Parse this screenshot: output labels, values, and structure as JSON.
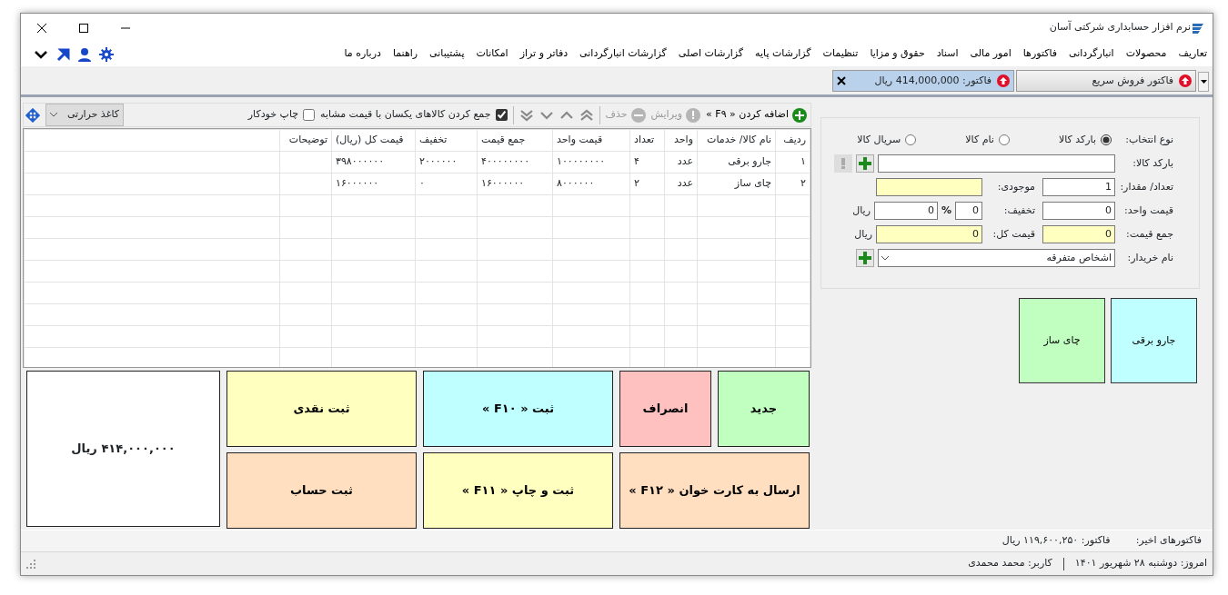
{
  "window": {
    "title": "نرم افزار حسابداری شرکتی آسان"
  },
  "menu": [
    "تعاریف",
    "محصولات",
    "انبارگردانی",
    "فاکتورها",
    "امور مالی",
    "اسناد",
    "حقوق و مزایا",
    "تنظیمات",
    "گزارشات پایه",
    "گزارشات اصلی",
    "گزارشات انبارگردانی",
    "دفاتر و تراز",
    "امکانات",
    "پشتیبانی",
    "راهنما",
    "درباره ما"
  ],
  "tabs": [
    {
      "label": "فاکتور فروش سریع",
      "selected": false,
      "closable": false
    },
    {
      "label": "فاکتور: 414,000,000 ریال",
      "selected": true,
      "closable": true
    }
  ],
  "toolbar": {
    "add": {
      "label": "اضافه کردن « F۹ »",
      "disabled": false
    },
    "edit": {
      "label": "ویرایش",
      "disabled": true
    },
    "delete": {
      "label": "حذف",
      "disabled": true
    },
    "merge_same": {
      "label": "جمع کردن کالاهای یکسان با قیمت مشابه",
      "checked": true
    },
    "auto_print": {
      "label": "چاپ خودکار",
      "checked": false
    },
    "paper": {
      "value": "کاغذ حرارتی"
    }
  },
  "table": {
    "columns": [
      "ردیف",
      "نام کالا/ خدمات",
      "واحد",
      "تعداد",
      "قیمت واحد",
      "جمع قیمت",
      "تخفیف",
      "قیمت کل (ریال)",
      "توضیحات"
    ],
    "rows": [
      [
        "۱",
        "جارو برقی",
        "عدد",
        "۴",
        "۱۰۰۰۰۰۰۰۰",
        "۴۰۰۰۰۰۰۰۰",
        "۲۰۰۰۰۰۰",
        "۳۹۸۰۰۰۰۰۰",
        ""
      ],
      [
        "۲",
        "چای ساز",
        "عدد",
        "۲",
        "۸۰۰۰۰۰۰",
        "۱۶۰۰۰۰۰۰",
        "۰",
        "۱۶۰۰۰۰۰۰",
        ""
      ]
    ]
  },
  "actions": {
    "row_1": [
      {
        "label": "جدید",
        "color": "#c0ffc0"
      },
      {
        "label": "انصراف",
        "color": "#ffc0c0"
      },
      {
        "label": "ثبت « F۱۰ »",
        "color": "#c0ffff"
      },
      {
        "label": "ثبت نقدی",
        "color": "#ffffc0"
      }
    ],
    "row_2": [
      {
        "label": "ارسال به کارت خوان « F۱۲ »",
        "color": "#ffdfc0"
      },
      {
        "label": "ثبت و چاپ « F۱۱ »",
        "color": "#ffffc0"
      },
      {
        "label": "ثبت حساب",
        "color": "#ffdfc0"
      }
    ],
    "total": "۴۱۴,۰۰۰,۰۰۰ ریال"
  },
  "form": {
    "selection": {
      "label": "نوع انتخاب:",
      "options": [
        {
          "label": "بارکد کالا",
          "selected": true
        },
        {
          "label": "نام کالا",
          "selected": false
        },
        {
          "label": "سریال کالا",
          "selected": false
        }
      ]
    },
    "barcode": {
      "label": "بارکد کالا:",
      "readonly": false
    },
    "quantity": {
      "label": "تعداد/ مقدار:",
      "value": "1",
      "readonly": false
    },
    "stock": {
      "label": "موجودی:",
      "readonly": true
    },
    "unit_price": {
      "label": "قیمت واحد:",
      "value": "0",
      "readonly": false
    },
    "discount": {
      "label": "تخفیف:",
      "percent": "0",
      "percent_sign": "%",
      "amount": "0",
      "currency": "ریال"
    },
    "sum": {
      "label": "جمع قیمت:",
      "value": "0",
      "readonly": true
    },
    "total": {
      "label": "قیمت کل:",
      "value": "0",
      "readonly": true,
      "currency": "ریال"
    },
    "buyer": {
      "label": "نام خریدار:",
      "value": "اشخاص متفرقه"
    }
  },
  "quick_items": [
    {
      "label": "جارو برقی",
      "color": "#c0ffff"
    },
    {
      "label": "چای ساز",
      "color": "#c0ffc0"
    }
  ],
  "status_bar": {
    "recent_label": "فاکتورهای اخیر:",
    "recent_invoice": "فاکتور: ۱۱۹,۶۰۰,۲۵۰ ریال",
    "today": "امروز: دوشنبه ۲۸ شهریور ۱۴۰۱",
    "user": "کاربر: محمد محمدی"
  }
}
